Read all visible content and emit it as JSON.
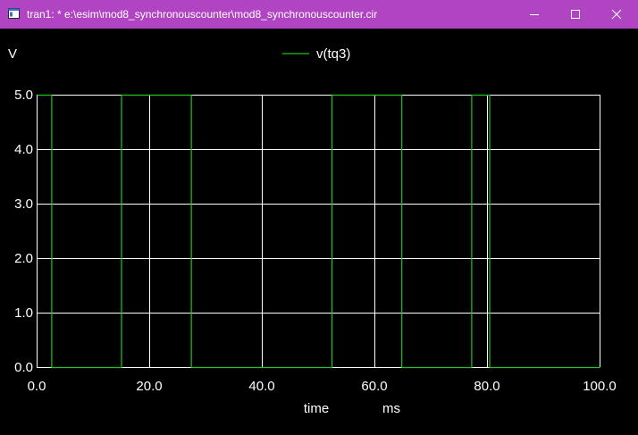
{
  "window": {
    "title": "tran1: * e:\\esim\\mod8_synchronouscounter\\mod8_synchronouscounter.cir",
    "titlebar_color": "#b144c2",
    "buttons": [
      "minimize-icon",
      "maximize-icon",
      "close-icon"
    ]
  },
  "chart_data": {
    "type": "line",
    "ylabel": "V",
    "xlabel": "time",
    "xunit": "ms",
    "xlim": [
      0,
      100
    ],
    "ylim": [
      0,
      5
    ],
    "x_ticks": [
      "0.0",
      "20.0",
      "40.0",
      "60.0",
      "80.0",
      "100.0"
    ],
    "y_ticks": [
      "0.0",
      "1.0",
      "2.0",
      "3.0",
      "4.0",
      "5.0"
    ],
    "grid": true,
    "grid_color": "#ffffff",
    "background": "#000000",
    "legend": "top-center",
    "series": [
      {
        "name": "v(tq3)",
        "color": "#22c322",
        "x": [
          0,
          2.6,
          2.6,
          15.0,
          15.0,
          27.4,
          27.4,
          52.4,
          52.4,
          64.8,
          64.8,
          77.2,
          77.2,
          80.4,
          80.4,
          100
        ],
        "y": [
          5,
          5,
          0,
          0,
          5,
          5,
          0,
          0,
          5,
          5,
          0,
          0,
          5,
          5,
          0,
          0
        ]
      }
    ]
  }
}
